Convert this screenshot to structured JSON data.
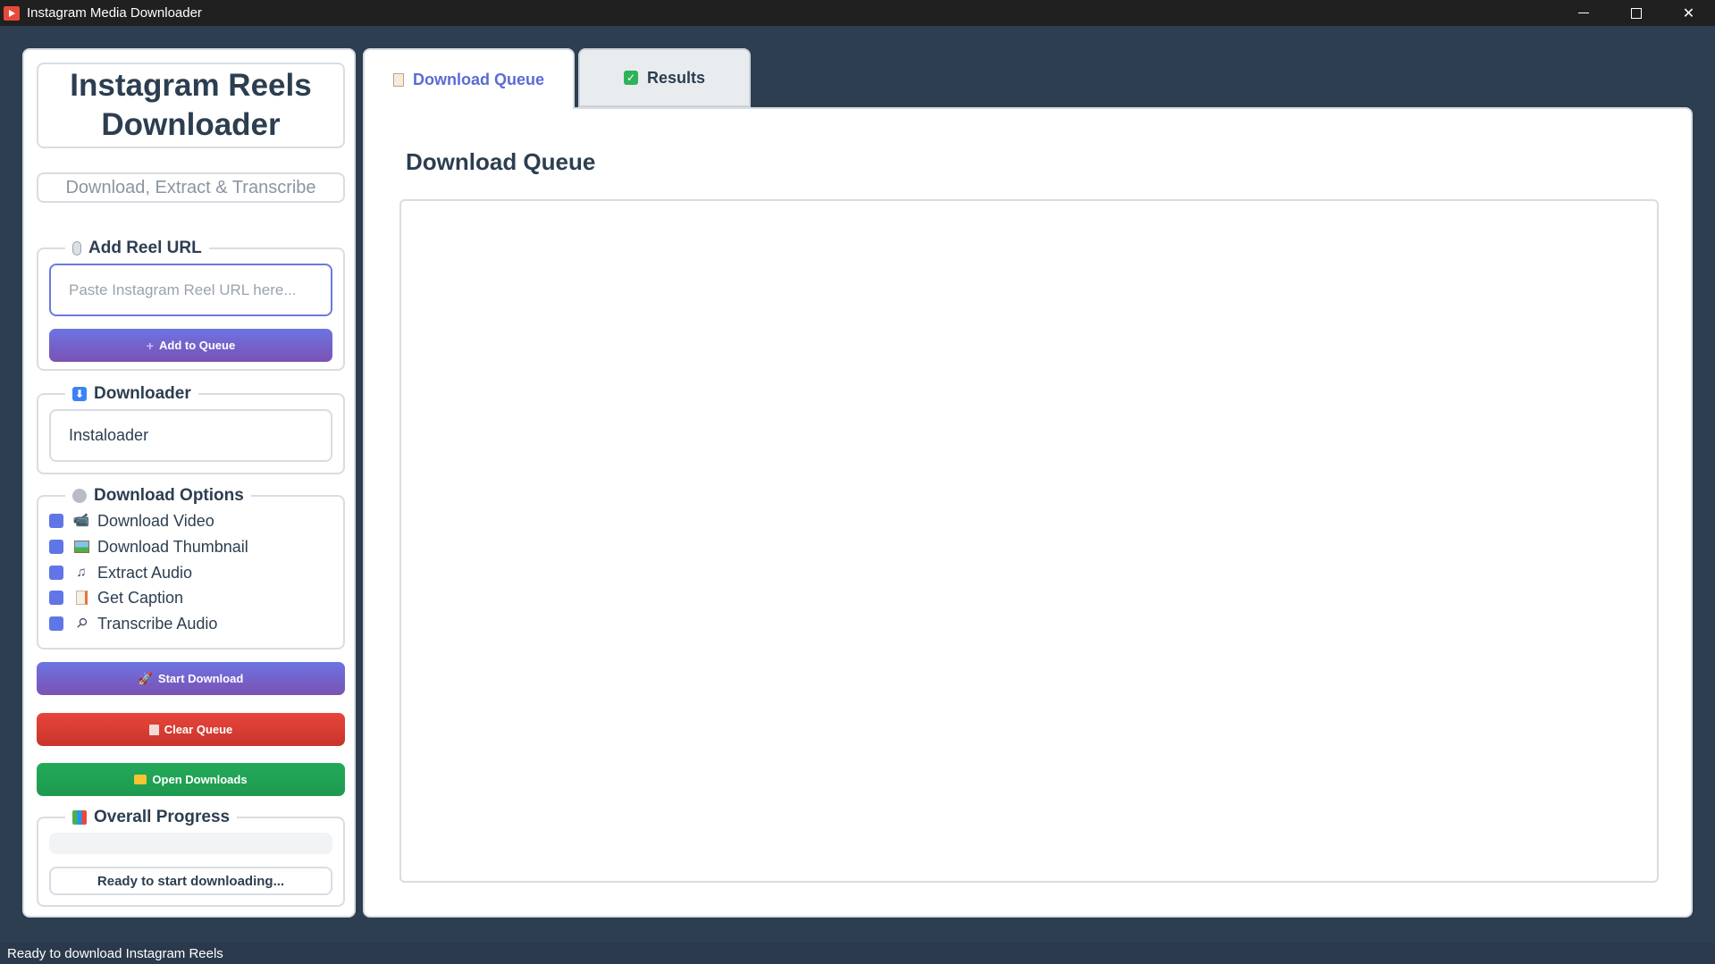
{
  "window": {
    "title": "Instagram Media Downloader"
  },
  "sidebar": {
    "heading_line1": "Instagram Reels",
    "heading_line2": "Downloader",
    "subtitle": "Download, Extract & Transcribe",
    "add_url": {
      "title": "Add Reel URL",
      "placeholder": "Paste Instagram Reel URL here...",
      "value": "",
      "button_label": "Add to Queue"
    },
    "downloader": {
      "title": "Downloader",
      "selected": "Instaloader"
    },
    "options": {
      "title": "Download Options",
      "items": [
        {
          "label": "Download Video",
          "icon": "video-camera-icon",
          "checked": true
        },
        {
          "label": "Download Thumbnail",
          "icon": "picture-icon",
          "checked": true
        },
        {
          "label": "Extract Audio",
          "icon": "music-note-icon",
          "checked": true
        },
        {
          "label": "Get Caption",
          "icon": "memo-icon",
          "checked": true
        },
        {
          "label": "Transcribe Audio",
          "icon": "microphone-icon",
          "checked": true
        }
      ]
    },
    "start_button": "Start Download",
    "clear_button": "Clear Queue",
    "open_button": "Open Downloads",
    "progress": {
      "title": "Overall Progress",
      "value": 0,
      "status": "Ready to start downloading..."
    }
  },
  "tabs": [
    {
      "label": "Download Queue",
      "active": true,
      "icon": "clipboard-icon"
    },
    {
      "label": "Results",
      "active": false,
      "icon": "check-box-icon"
    }
  ],
  "main": {
    "title": "Download Queue",
    "queue_items": []
  },
  "statusbar": {
    "text": "Ready to download Instagram Reels"
  },
  "colors": {
    "accent": "#6c74e3",
    "danger": "#e8453b",
    "success": "#23a95a",
    "background": "#2c3e50"
  }
}
